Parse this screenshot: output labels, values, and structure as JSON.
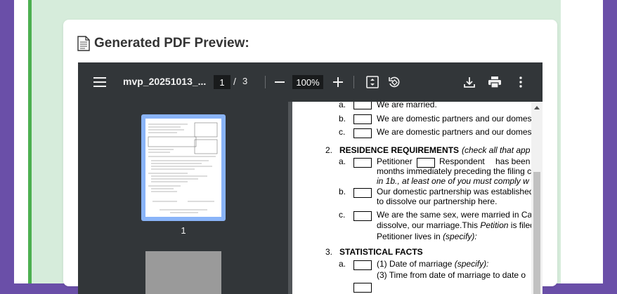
{
  "preview": {
    "title": "Generated PDF Preview:"
  },
  "viewer": {
    "filename": "mvp_20251013_...",
    "current_page": "1",
    "page_separator": "/",
    "total_pages": "3",
    "zoom": "100%",
    "thumbnail_label": "1"
  },
  "icons": {
    "menu": "hamburger-icon",
    "zoom_out": "minus-icon",
    "zoom_in": "plus-icon",
    "fit": "fit-page-icon",
    "rotate": "rotate-icon",
    "download": "download-icon",
    "print": "print-icon",
    "more": "more-vert-icon",
    "doc": "document-icon"
  },
  "colors": {
    "page_bg": "#6a4fa8",
    "panel_green": "#d6ecdb",
    "accent_green": "#4caf50",
    "toolbar": "#323639",
    "thumb_selected": "#8ab4f8"
  },
  "document": {
    "item1_a": "a.",
    "item1_a_text": "We are married.",
    "item1_b": "b.",
    "item1_b_text": "We are domestic partners and our domes",
    "item1_c": "c.",
    "item1_c_text": "We are domestic partners and our domes",
    "sec2_num": "2.",
    "sec2_title": "RESIDENCE REQUIREMENTS",
    "sec2_note": "(check all that app",
    "sec2_a": "a.",
    "sec2_a_petitioner": "Petitioner",
    "sec2_a_respondent": "Respondent",
    "sec2_a_tail": "has been",
    "sec2_a_line2": "months immediately preceding the filing c",
    "sec2_a_line3": "in 1b., at least one of you must comply w",
    "sec2_b": "b.",
    "sec2_b_line1": "Our domestic partnership was established",
    "sec2_b_line2": "to dissolve our partnership here.",
    "sec2_c": "c.",
    "sec2_c_line1": "We are the same sex, were married in Cal",
    "sec2_c_line2a": "dissolve, our marriage.This",
    "sec2_c_line2b": "Petition",
    "sec2_c_line2c": "is filed",
    "sec2_c_line3a": "Petitioner lives in",
    "sec2_c_line3b": "(specify):",
    "sec3_num": "3.",
    "sec3_title": "STATISTICAL FACTS",
    "sec3_a": "a.",
    "sec3_a_1": "(1)  Date of marriage",
    "sec3_a_1b": "(specify):",
    "sec3_a_2": "(3)  Time from date of marriage to date o"
  }
}
